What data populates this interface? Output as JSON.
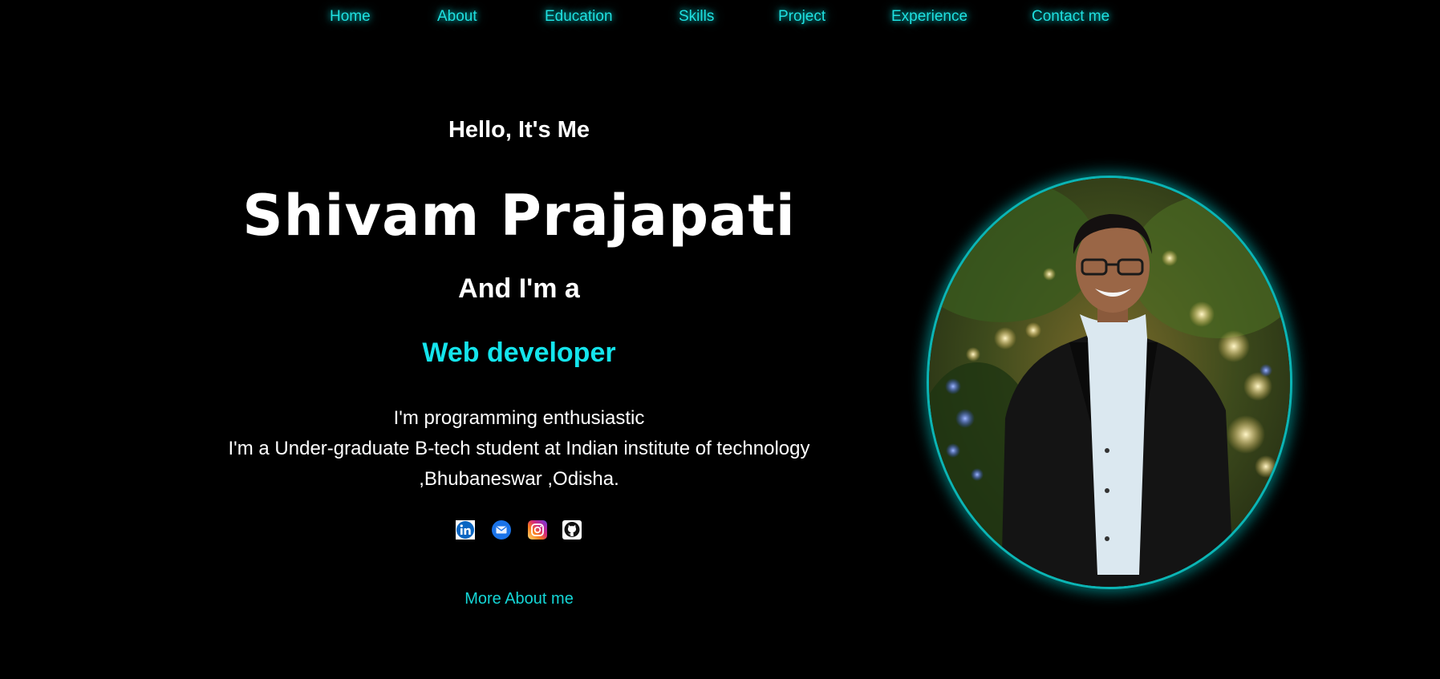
{
  "nav": {
    "items": [
      {
        "label": "Home"
      },
      {
        "label": "About"
      },
      {
        "label": "Education"
      },
      {
        "label": "Skills"
      },
      {
        "label": "Project"
      },
      {
        "label": "Experience"
      },
      {
        "label": "Contact me"
      }
    ]
  },
  "hero": {
    "greeting": "Hello, It's Me",
    "name": "Shivam Prajapati",
    "intro": "And I'm a",
    "role": "Web developer",
    "bio_lines": [
      "I'm programming enthusiastic",
      "I'm a Under-graduate B-tech student at Indian institute of technology",
      ",Bhubaneswar ,Odisha."
    ],
    "more_link": "More About me"
  },
  "socials": [
    {
      "icon": "linkedin-icon"
    },
    {
      "icon": "mail-icon"
    },
    {
      "icon": "instagram-icon"
    },
    {
      "icon": "github-icon"
    }
  ],
  "colors": {
    "background": "#000000",
    "accent": "#14e4ec",
    "nav_text": "#1fe0e0",
    "text": "#ffffff"
  }
}
